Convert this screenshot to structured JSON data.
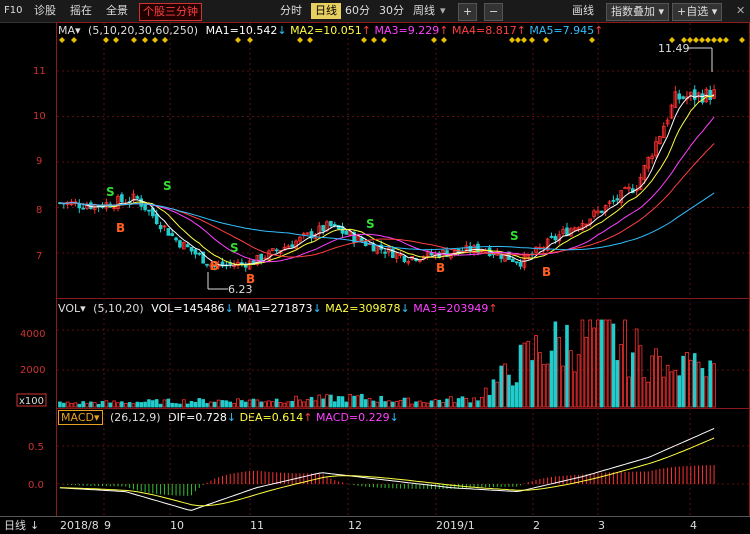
{
  "toolbar": {
    "f10": "F10",
    "diagnose": "诊股",
    "select": "摇在",
    "fullview": "全景",
    "stock_3min": "个股三分钟",
    "period_items": [
      "分时",
      "日线",
      "60分",
      "30分",
      "周线"
    ],
    "plus": "+",
    "minus": "−",
    "draw_line": "画线",
    "index_overlay": "指数叠加",
    "add_select": "+自选"
  },
  "legends": {
    "price": {
      "name": "MA",
      "params": "(5,10,20,30,60,250)",
      "ma1": "MA1=10.542",
      "ma2": "MA2=10.051",
      "ma3": "MA3=9.229",
      "ma4": "MA4=8.817",
      "ma5": "MA5=7.945"
    },
    "vol": {
      "name": "VOL",
      "params": "(5,10,20)",
      "vol": "VOL=145486",
      "ma1": "MA1=271873",
      "ma2": "MA2=309878",
      "ma3": "MA3=203949"
    },
    "macd": {
      "name": "MACD",
      "params": "(26,12,9)",
      "dif": "DIF=0.728",
      "dea": "DEA=0.614",
      "macd": "MACD=0.229"
    }
  },
  "axis": {
    "price_ticks": [
      "11",
      "10",
      "9",
      "8",
      "7"
    ],
    "vol_ticks": [
      "4000",
      "2000"
    ],
    "vol_unit": "x100",
    "macd_ticks": [
      "0.5",
      "0.0"
    ],
    "date_ticks": [
      "2018/8",
      "9",
      "10",
      "11",
      "12",
      "2019/1",
      "2",
      "3",
      "4"
    ],
    "period_label": "日线"
  },
  "annotations": {
    "high": "11.49",
    "low": "6.23",
    "sell_mark": "S",
    "buy_mark": "B"
  },
  "colors": {
    "up": "#ff3030",
    "down": "#22cccc",
    "ma1": "#ffffff",
    "ma2": "#ffff40",
    "ma3": "#ff40ff",
    "ma4": "#ff4040",
    "ma5": "#30c0ff"
  },
  "chart_data": {
    "type": "candlestick",
    "x_range": [
      "2018/8",
      "2019/4"
    ],
    "price_ylim": [
      6.23,
      11.49
    ],
    "keypoints": [
      {
        "date": "2018/8",
        "close": 8.1
      },
      {
        "date": "9",
        "close": 8.05
      },
      {
        "date": "9 mid",
        "close": 8.2
      },
      {
        "date": "10 start",
        "close": 7.3
      },
      {
        "date": "10",
        "close": 6.7
      },
      {
        "date": "10 end",
        "close": 6.8
      },
      {
        "date": "11",
        "close": 7.2
      },
      {
        "date": "11 mid",
        "close": 7.6
      },
      {
        "date": "12",
        "close": 7.2
      },
      {
        "date": "12 end",
        "close": 6.9
      },
      {
        "date": "2019/1",
        "close": 7.0
      },
      {
        "date": "1 mid",
        "close": 7.1
      },
      {
        "date": "2",
        "close": 6.8
      },
      {
        "date": "2 mid",
        "close": 7.4
      },
      {
        "date": "3",
        "close": 7.9
      },
      {
        "date": "3 end",
        "close": 8.5
      },
      {
        "date": "4",
        "close": 10.4
      },
      {
        "date": "4 end",
        "close": 10.5
      }
    ],
    "volume_keypoints": [
      200,
      250,
      300,
      350,
      400,
      500,
      300,
      450,
      3000,
      4000,
      2500,
      1500
    ],
    "macd_keypoints": [
      -0.05,
      -0.1,
      -0.35,
      -0.05,
      0.15,
      0.05,
      -0.05,
      -0.1,
      0.1,
      0.35,
      0.73
    ]
  }
}
